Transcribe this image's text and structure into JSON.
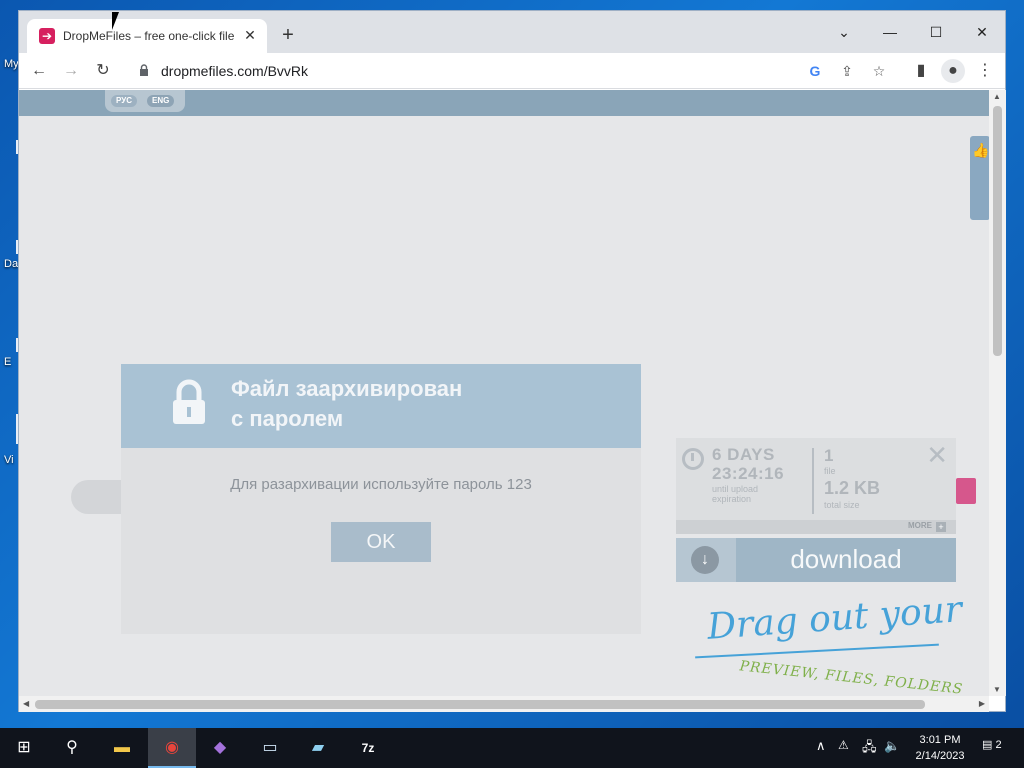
{
  "desktop": {
    "icons": [
      {
        "label": "My"
      },
      {
        "label": ""
      },
      {
        "label": "Da"
      },
      {
        "label": "E"
      },
      {
        "label": "Vi"
      }
    ]
  },
  "browser": {
    "tab": {
      "title": "DropMeFiles – free one-click file",
      "close": "✕",
      "favicon": "➔"
    },
    "new_tab": "+",
    "window_buttons": {
      "tabsearch": "⌄",
      "minimize": "—",
      "maximize": "☐",
      "close": "✕"
    },
    "toolbar": {
      "back": "←",
      "forward": "→",
      "reload": "↻",
      "url": "dropmefiles.com/BvvRk",
      "google": "G",
      "share": "⇪",
      "bookmark": "☆",
      "sidepanel": "▮",
      "profile": "●",
      "menu": "⋮"
    }
  },
  "page": {
    "lang": {
      "ru": "РУС",
      "en": "ENG"
    },
    "modal": {
      "title_line1": "Файл заархивирован",
      "title_line2": "с паролем",
      "message": "Для разархивации используйте пароль 123",
      "ok_label": "OK"
    },
    "file_info": {
      "days": "6 DAYS",
      "time": "23:24:16",
      "expiry_label": "until upload expiration",
      "files_count": "1",
      "files_label": "file",
      "total_size": "1.2 KB",
      "size_label": "total size",
      "more_label": "MORE",
      "more_icon": "+",
      "close": "✕"
    },
    "download": {
      "icon": "↓",
      "label": "download"
    },
    "drag_text_1": "Drag out your",
    "drag_text_2": "PREVIEW, FILES, FOLDERS",
    "thumb_icon": "👍"
  },
  "scroll": {
    "up": "▲",
    "down": "▼",
    "left": "◀",
    "right": "▶"
  },
  "taskbar": {
    "start": "⊞",
    "search": "⚲",
    "apps": [
      {
        "name": "file-explorer",
        "glyph": "▬"
      },
      {
        "name": "chrome",
        "glyph": "◉"
      },
      {
        "name": "visual-studio",
        "glyph": "◆"
      },
      {
        "name": "window-app",
        "glyph": "▭"
      },
      {
        "name": "notepad",
        "glyph": "▰"
      },
      {
        "name": "7zip",
        "glyph": "7z"
      }
    ],
    "tray": {
      "chevron": "∧",
      "network": "🖧",
      "volume": "🔈"
    },
    "clock": {
      "time": "3:01 PM",
      "date": "2/14/2023"
    },
    "notifications": "2"
  },
  "colors": {
    "modal_header": "#a9c2d4",
    "download_button": "#9fb6c6",
    "accent_pink": "#d6578c",
    "drag_blue": "#46a2d8",
    "drag_green": "#7fb04a"
  }
}
